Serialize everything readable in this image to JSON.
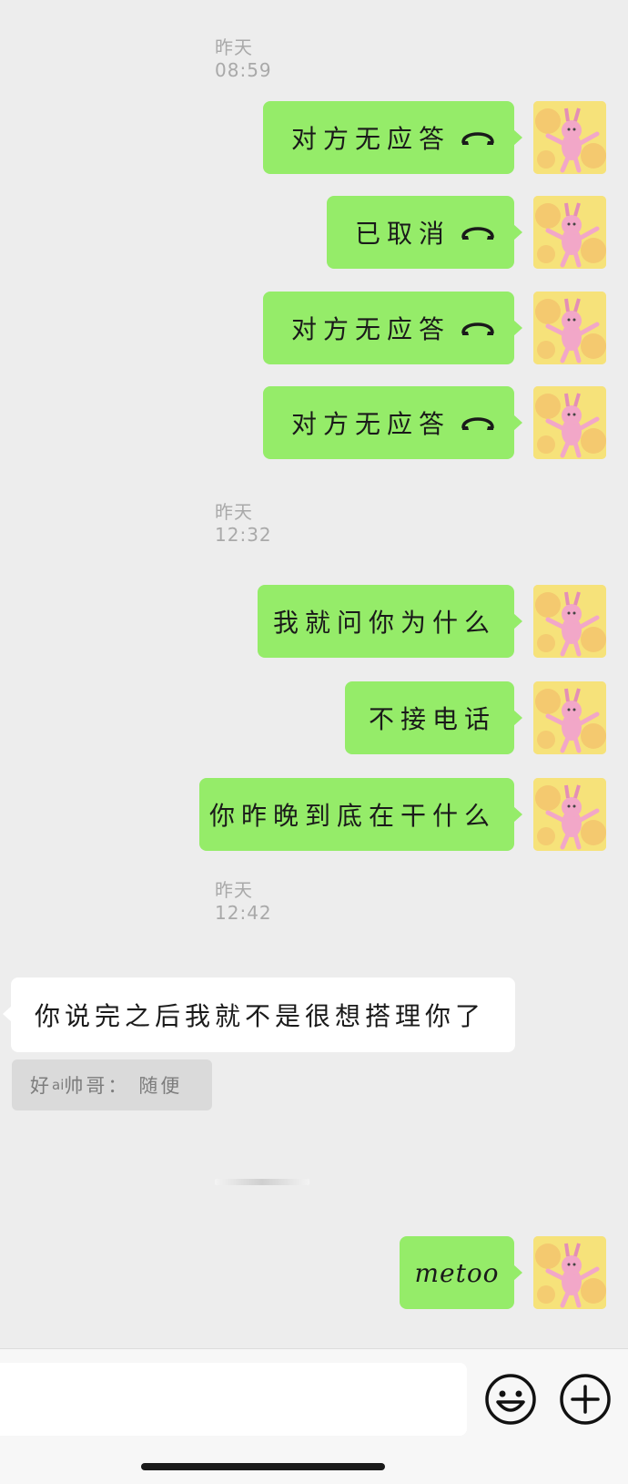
{
  "chat": {
    "timestamps": [
      "昨天 08:59",
      "昨天 12:32",
      "昨天 12:42"
    ],
    "messages": [
      {
        "direction": "out",
        "text": "对方无应答",
        "icon": "phone-hangup-icon"
      },
      {
        "direction": "out",
        "text": "已取消",
        "icon": "phone-hangup-icon"
      },
      {
        "direction": "out",
        "text": "对方无应答",
        "icon": "phone-hangup-icon"
      },
      {
        "direction": "out",
        "text": "对方无应答",
        "icon": "phone-hangup-icon"
      },
      {
        "direction": "out",
        "text": "我就问你为什么"
      },
      {
        "direction": "out",
        "text": "不接电话"
      },
      {
        "direction": "out",
        "text": "你昨晚到底在干什么"
      },
      {
        "direction": "in",
        "text": "你说完之后我就不是很想搭理你了"
      },
      {
        "direction": "out",
        "text": "metoo"
      }
    ],
    "quote": {
      "name_prefix": "好",
      "name_sup": "ai",
      "name_suffix": "帅哥：",
      "text": "随便"
    }
  },
  "input": {
    "value": "",
    "emoji_icon": "emoji-icon",
    "plus_icon": "plus-icon"
  },
  "colors": {
    "outgoing": "#95ec69",
    "incoming": "#ffffff",
    "background": "#ededed"
  }
}
